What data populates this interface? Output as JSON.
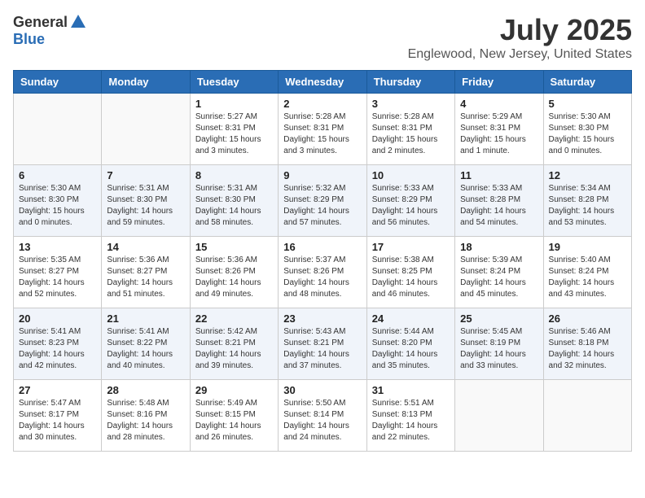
{
  "header": {
    "logo_general": "General",
    "logo_blue": "Blue",
    "month": "July 2025",
    "location": "Englewood, New Jersey, United States"
  },
  "weekdays": [
    "Sunday",
    "Monday",
    "Tuesday",
    "Wednesday",
    "Thursday",
    "Friday",
    "Saturday"
  ],
  "weeks": [
    [
      {
        "day": "",
        "info": ""
      },
      {
        "day": "",
        "info": ""
      },
      {
        "day": "1",
        "info": "Sunrise: 5:27 AM\nSunset: 8:31 PM\nDaylight: 15 hours and 3 minutes."
      },
      {
        "day": "2",
        "info": "Sunrise: 5:28 AM\nSunset: 8:31 PM\nDaylight: 15 hours and 3 minutes."
      },
      {
        "day": "3",
        "info": "Sunrise: 5:28 AM\nSunset: 8:31 PM\nDaylight: 15 hours and 2 minutes."
      },
      {
        "day": "4",
        "info": "Sunrise: 5:29 AM\nSunset: 8:31 PM\nDaylight: 15 hours and 1 minute."
      },
      {
        "day": "5",
        "info": "Sunrise: 5:30 AM\nSunset: 8:30 PM\nDaylight: 15 hours and 0 minutes."
      }
    ],
    [
      {
        "day": "6",
        "info": "Sunrise: 5:30 AM\nSunset: 8:30 PM\nDaylight: 15 hours and 0 minutes."
      },
      {
        "day": "7",
        "info": "Sunrise: 5:31 AM\nSunset: 8:30 PM\nDaylight: 14 hours and 59 minutes."
      },
      {
        "day": "8",
        "info": "Sunrise: 5:31 AM\nSunset: 8:30 PM\nDaylight: 14 hours and 58 minutes."
      },
      {
        "day": "9",
        "info": "Sunrise: 5:32 AM\nSunset: 8:29 PM\nDaylight: 14 hours and 57 minutes."
      },
      {
        "day": "10",
        "info": "Sunrise: 5:33 AM\nSunset: 8:29 PM\nDaylight: 14 hours and 56 minutes."
      },
      {
        "day": "11",
        "info": "Sunrise: 5:33 AM\nSunset: 8:28 PM\nDaylight: 14 hours and 54 minutes."
      },
      {
        "day": "12",
        "info": "Sunrise: 5:34 AM\nSunset: 8:28 PM\nDaylight: 14 hours and 53 minutes."
      }
    ],
    [
      {
        "day": "13",
        "info": "Sunrise: 5:35 AM\nSunset: 8:27 PM\nDaylight: 14 hours and 52 minutes."
      },
      {
        "day": "14",
        "info": "Sunrise: 5:36 AM\nSunset: 8:27 PM\nDaylight: 14 hours and 51 minutes."
      },
      {
        "day": "15",
        "info": "Sunrise: 5:36 AM\nSunset: 8:26 PM\nDaylight: 14 hours and 49 minutes."
      },
      {
        "day": "16",
        "info": "Sunrise: 5:37 AM\nSunset: 8:26 PM\nDaylight: 14 hours and 48 minutes."
      },
      {
        "day": "17",
        "info": "Sunrise: 5:38 AM\nSunset: 8:25 PM\nDaylight: 14 hours and 46 minutes."
      },
      {
        "day": "18",
        "info": "Sunrise: 5:39 AM\nSunset: 8:24 PM\nDaylight: 14 hours and 45 minutes."
      },
      {
        "day": "19",
        "info": "Sunrise: 5:40 AM\nSunset: 8:24 PM\nDaylight: 14 hours and 43 minutes."
      }
    ],
    [
      {
        "day": "20",
        "info": "Sunrise: 5:41 AM\nSunset: 8:23 PM\nDaylight: 14 hours and 42 minutes."
      },
      {
        "day": "21",
        "info": "Sunrise: 5:41 AM\nSunset: 8:22 PM\nDaylight: 14 hours and 40 minutes."
      },
      {
        "day": "22",
        "info": "Sunrise: 5:42 AM\nSunset: 8:21 PM\nDaylight: 14 hours and 39 minutes."
      },
      {
        "day": "23",
        "info": "Sunrise: 5:43 AM\nSunset: 8:21 PM\nDaylight: 14 hours and 37 minutes."
      },
      {
        "day": "24",
        "info": "Sunrise: 5:44 AM\nSunset: 8:20 PM\nDaylight: 14 hours and 35 minutes."
      },
      {
        "day": "25",
        "info": "Sunrise: 5:45 AM\nSunset: 8:19 PM\nDaylight: 14 hours and 33 minutes."
      },
      {
        "day": "26",
        "info": "Sunrise: 5:46 AM\nSunset: 8:18 PM\nDaylight: 14 hours and 32 minutes."
      }
    ],
    [
      {
        "day": "27",
        "info": "Sunrise: 5:47 AM\nSunset: 8:17 PM\nDaylight: 14 hours and 30 minutes."
      },
      {
        "day": "28",
        "info": "Sunrise: 5:48 AM\nSunset: 8:16 PM\nDaylight: 14 hours and 28 minutes."
      },
      {
        "day": "29",
        "info": "Sunrise: 5:49 AM\nSunset: 8:15 PM\nDaylight: 14 hours and 26 minutes."
      },
      {
        "day": "30",
        "info": "Sunrise: 5:50 AM\nSunset: 8:14 PM\nDaylight: 14 hours and 24 minutes."
      },
      {
        "day": "31",
        "info": "Sunrise: 5:51 AM\nSunset: 8:13 PM\nDaylight: 14 hours and 22 minutes."
      },
      {
        "day": "",
        "info": ""
      },
      {
        "day": "",
        "info": ""
      }
    ]
  ]
}
